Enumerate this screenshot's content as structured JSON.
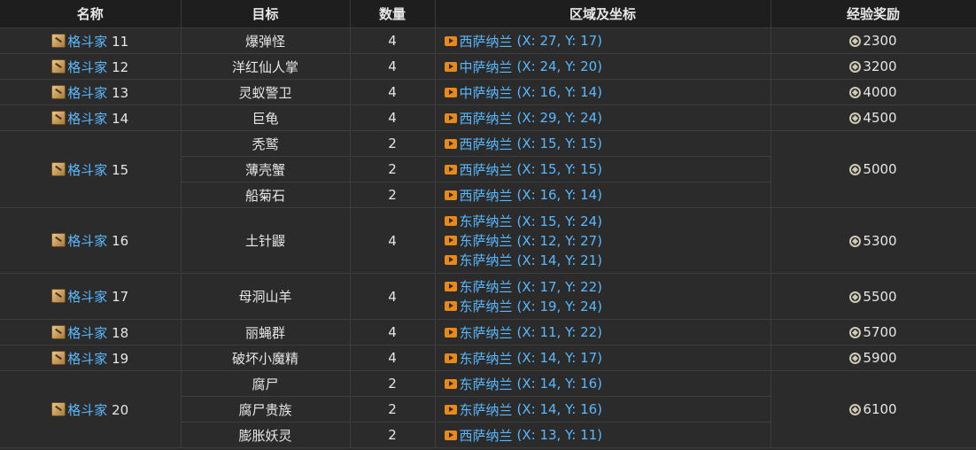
{
  "headers": [
    "名称",
    "目标",
    "数量",
    "区域及坐标",
    "经验奖励"
  ],
  "rows": [
    {
      "name": "格斗家",
      "num": "11",
      "exp": "2300",
      "targets": [
        {
          "target": "爆弹怪",
          "count": "4",
          "locs": [
            {
              "zone": "西萨纳兰",
              "coord": "(X: 27, Y: 17)"
            }
          ]
        }
      ]
    },
    {
      "name": "格斗家",
      "num": "12",
      "exp": "3200",
      "targets": [
        {
          "target": "洋红仙人掌",
          "count": "4",
          "locs": [
            {
              "zone": "中萨纳兰",
              "coord": "(X: 24, Y: 20)"
            }
          ]
        }
      ]
    },
    {
      "name": "格斗家",
      "num": "13",
      "exp": "4000",
      "targets": [
        {
          "target": "灵蚁警卫",
          "count": "4",
          "locs": [
            {
              "zone": "中萨纳兰",
              "coord": "(X: 16, Y: 14)"
            }
          ]
        }
      ]
    },
    {
      "name": "格斗家",
      "num": "14",
      "exp": "4500",
      "targets": [
        {
          "target": "巨龟",
          "count": "4",
          "locs": [
            {
              "zone": "西萨纳兰",
              "coord": "(X: 29, Y: 24)"
            }
          ]
        }
      ]
    },
    {
      "name": "格斗家",
      "num": "15",
      "exp": "5000",
      "targets": [
        {
          "target": "秃鹫",
          "count": "2",
          "locs": [
            {
              "zone": "西萨纳兰",
              "coord": "(X: 15, Y: 15)"
            }
          ]
        },
        {
          "target": "薄壳蟹",
          "count": "2",
          "locs": [
            {
              "zone": "西萨纳兰",
              "coord": "(X: 15, Y: 15)"
            }
          ]
        },
        {
          "target": "船菊石",
          "count": "2",
          "locs": [
            {
              "zone": "西萨纳兰",
              "coord": "(X: 16, Y: 14)"
            }
          ]
        }
      ]
    },
    {
      "name": "格斗家",
      "num": "16",
      "exp": "5300",
      "targets": [
        {
          "target": "土针鼹",
          "count": "4",
          "locs": [
            {
              "zone": "东萨纳兰",
              "coord": "(X: 15, Y: 24)"
            },
            {
              "zone": "东萨纳兰",
              "coord": "(X: 12, Y: 27)"
            },
            {
              "zone": "东萨纳兰",
              "coord": "(X: 14, Y: 21)"
            }
          ]
        }
      ]
    },
    {
      "name": "格斗家",
      "num": "17",
      "exp": "5500",
      "targets": [
        {
          "target": "母洞山羊",
          "count": "4",
          "locs": [
            {
              "zone": "东萨纳兰",
              "coord": "(X: 17, Y: 22)"
            },
            {
              "zone": "东萨纳兰",
              "coord": "(X: 19, Y: 24)"
            }
          ]
        }
      ]
    },
    {
      "name": "格斗家",
      "num": "18",
      "exp": "5700",
      "targets": [
        {
          "target": "丽蝇群",
          "count": "4",
          "locs": [
            {
              "zone": "东萨纳兰",
              "coord": "(X: 11, Y: 22)"
            }
          ]
        }
      ]
    },
    {
      "name": "格斗家",
      "num": "19",
      "exp": "5900",
      "targets": [
        {
          "target": "破坏小魔精",
          "count": "4",
          "locs": [
            {
              "zone": "东萨纳兰",
              "coord": "(X: 14, Y: 17)"
            }
          ]
        }
      ]
    },
    {
      "name": "格斗家",
      "num": "20",
      "exp": "6100",
      "targets": [
        {
          "target": "腐尸",
          "count": "2",
          "locs": [
            {
              "zone": "东萨纳兰",
              "coord": "(X: 14, Y: 16)"
            }
          ]
        },
        {
          "target": "腐尸贵族",
          "count": "2",
          "locs": [
            {
              "zone": "东萨纳兰",
              "coord": "(X: 14, Y: 16)"
            }
          ]
        },
        {
          "target": "膨胀妖灵",
          "count": "2",
          "locs": [
            {
              "zone": "西萨纳兰",
              "coord": "(X: 13, Y: 11)"
            }
          ]
        }
      ]
    }
  ]
}
